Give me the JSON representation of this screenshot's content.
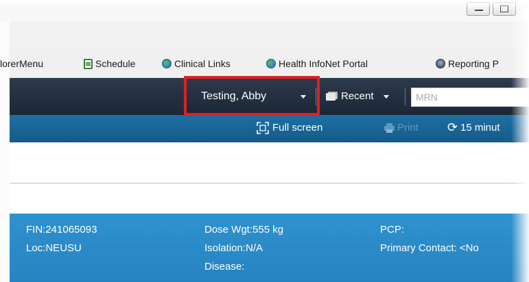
{
  "toolbar_links": [
    {
      "label": "lorerMenu",
      "icon": "none"
    },
    {
      "label": "Schedule",
      "icon": "schedule-icon"
    },
    {
      "label": "Clinical Links",
      "icon": "globe-icon"
    },
    {
      "label": "Health InfoNet Portal",
      "icon": "globe-icon"
    },
    {
      "label": "Reporting P",
      "icon": "reporting-icon"
    }
  ],
  "nav": {
    "patient_name": "Testing, Abby",
    "recent_label": "Recent",
    "mrn_placeholder": "MRN"
  },
  "tools": {
    "full_screen": "Full screen",
    "print": "Print",
    "refresh": "15 minut"
  },
  "banner": {
    "fin": "FIN:241065093",
    "loc": "Loc:NEUSU",
    "dose_wgt": "Dose Wgt:555 kg",
    "isolation": "Isolation:N/A",
    "disease": "Disease:",
    "pcp": "PCP:",
    "primary_contact": "Primary Contact: <No"
  },
  "colors": {
    "nav_bar": "#222f40",
    "tool_bar": "#1a66a0",
    "banner": "#2a8bc8",
    "highlight": "#e02020"
  }
}
